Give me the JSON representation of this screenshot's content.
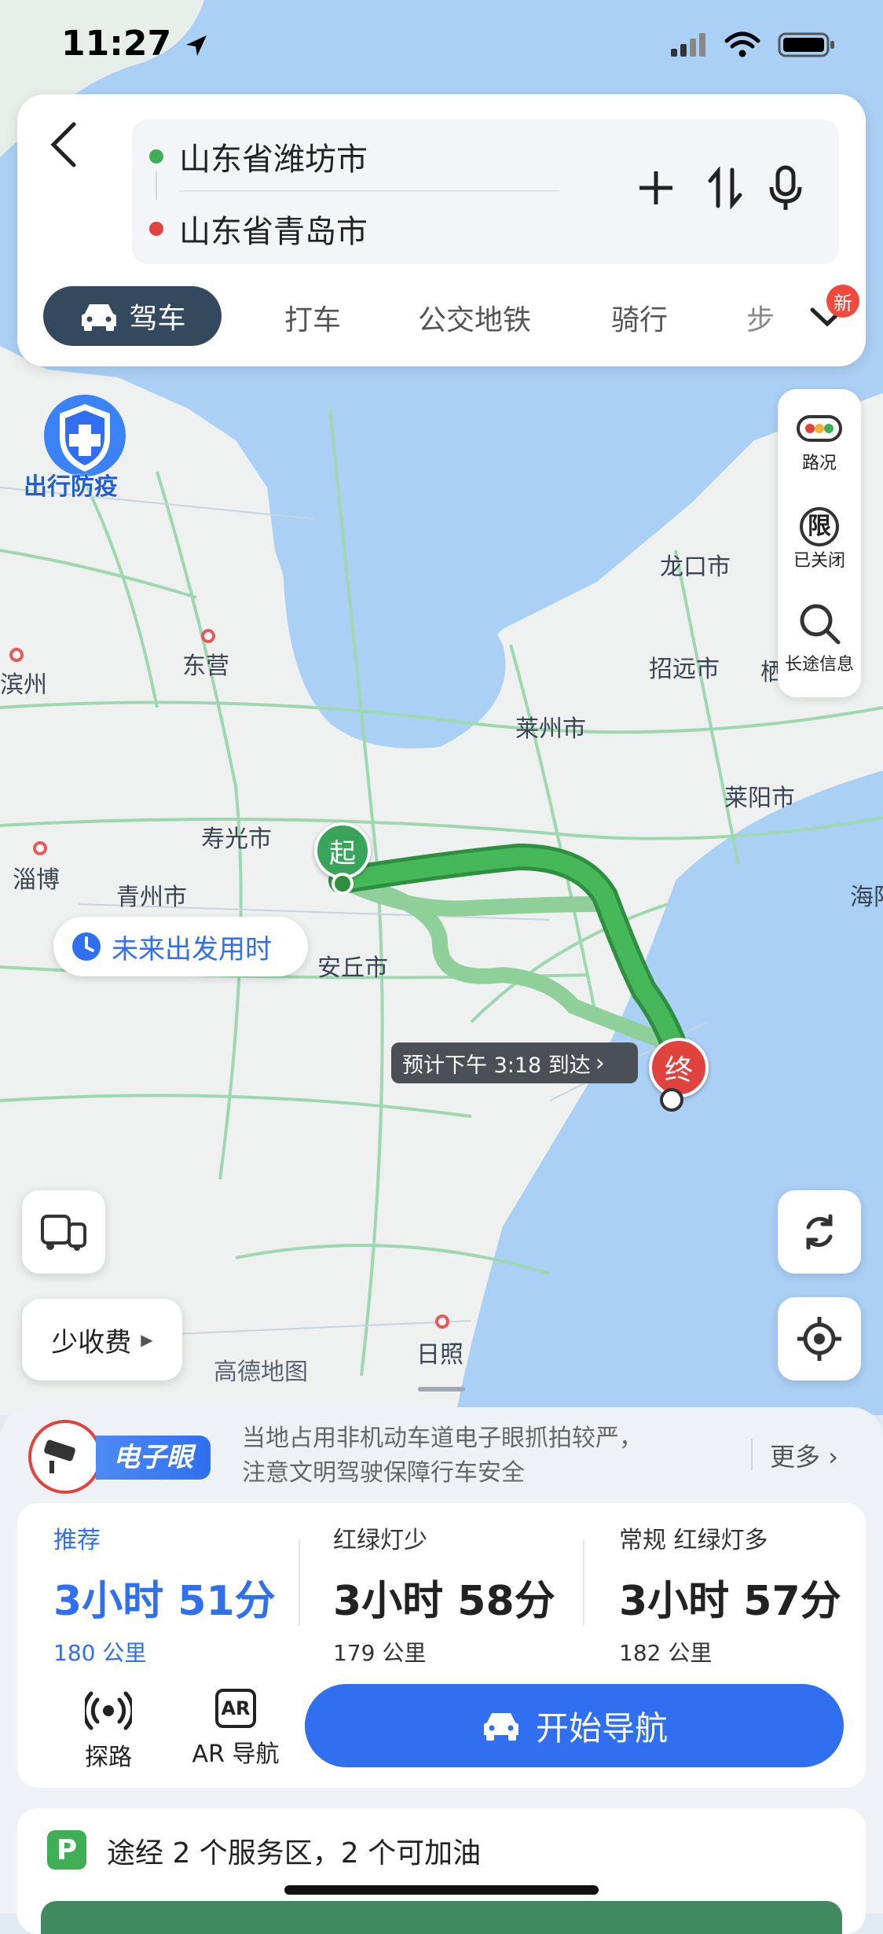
{
  "status_bar": {
    "time": "11:27"
  },
  "search": {
    "origin": "山东省潍坊市",
    "destination": "山东省青岛市"
  },
  "modes": {
    "active": "驾车",
    "taxi": "打车",
    "transit": "公交地铁",
    "bike": "骑行",
    "walk": "步",
    "new_badge": "新"
  },
  "map": {
    "epidemic_badge": "出行防疫",
    "labels": {
      "longkou": "龙口市",
      "zhaoyuan": "招远市",
      "dongying": "东营",
      "binzhou": "滨州",
      "laizhou": "莱州市",
      "laiyang": "莱阳市",
      "shouguang": "寿光市",
      "zibo": "淄博",
      "qingzhou": "青州市",
      "anqiu": "安丘市",
      "rizhao": "日照",
      "haiyang": "海阳",
      "qi": "栖",
      "amap": "高德地图"
    },
    "start_marker": "起",
    "end_marker": "终",
    "future_departure": "未来出发用时",
    "eta": "预计下午 3:18 到达",
    "less_toll": "少收费",
    "side_panel": {
      "traffic": "路况",
      "restrict_icon": "限",
      "restrict": "已关闭",
      "long_trip": "长途信息"
    }
  },
  "notice": {
    "badge": "电子眼",
    "text_line1": "当地占用非机动车道电子眼抓拍较严，",
    "text_line2": "注意文明驾驶保障行车安全",
    "more": "更多"
  },
  "routes": [
    {
      "tag": "推荐",
      "time": "3小时 51分",
      "distance": "180 公里"
    },
    {
      "tag": "红绿灯少",
      "time": "3小时 58分",
      "distance": "179 公里"
    },
    {
      "tag": "常规  红绿灯多",
      "time": "3小时 57分",
      "distance": "182 公里"
    }
  ],
  "actions": {
    "explore": "探路",
    "ar_icon": "AR",
    "ar_nav": "AR 导航",
    "start_nav": "开始导航"
  },
  "service": {
    "icon": "P",
    "text": "途经 2 个服务区，2 个可加油"
  },
  "colors": {
    "accent": "#2f6ff0",
    "route": "#3fae54",
    "dark_tab": "#34495e",
    "end_marker": "#e0423e"
  }
}
